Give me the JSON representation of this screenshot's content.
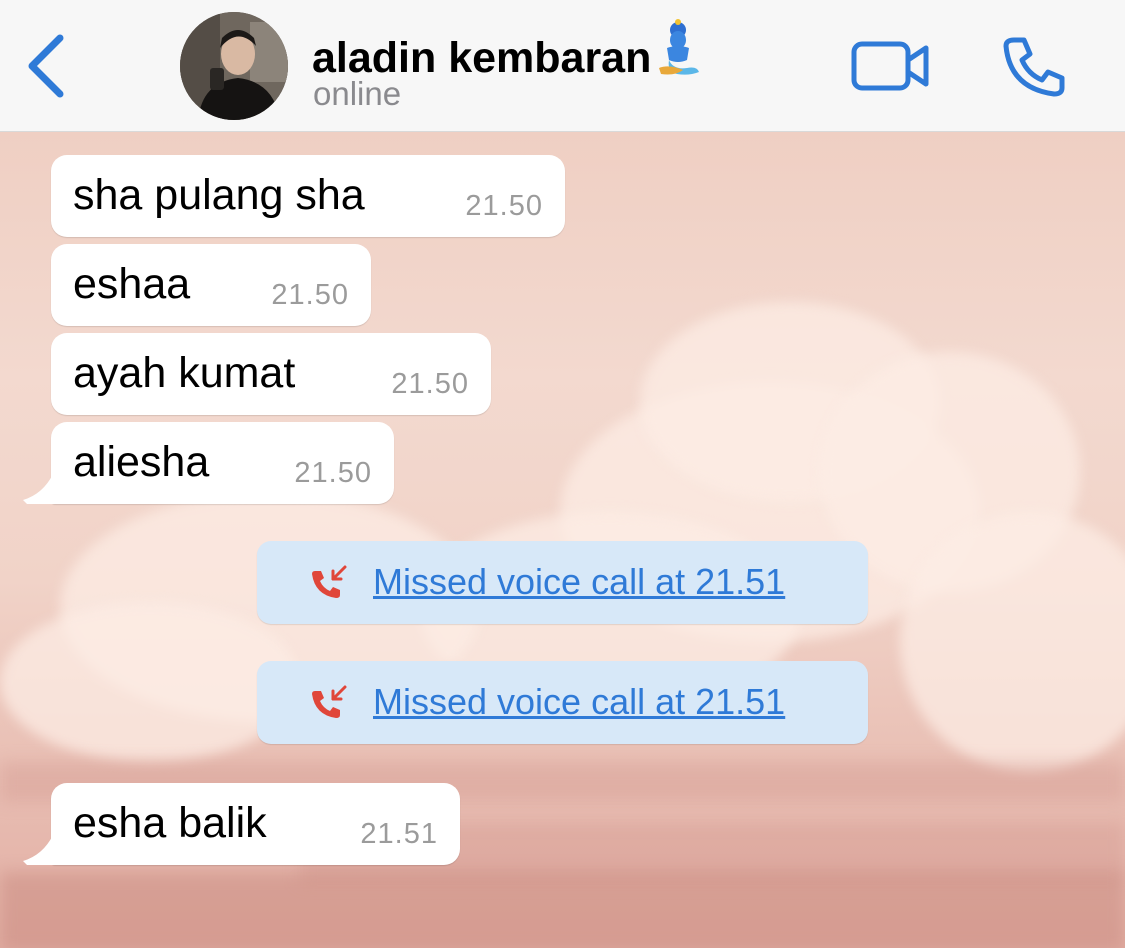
{
  "header": {
    "back_icon": "chevron-left-icon",
    "contact_name": "aladin kembaran",
    "name_emoji": "genie-icon",
    "status": "online",
    "video_icon": "video-camera-icon",
    "call_icon": "phone-icon",
    "accent_color": "#2f7ad7"
  },
  "messages": [
    {
      "text": "sha pulang sha",
      "time": "21.50"
    },
    {
      "text": "eshaa",
      "time": "21.50"
    },
    {
      "text": "ayah kumat",
      "time": "21.50"
    },
    {
      "text": "aliesha",
      "time": "21.50"
    },
    {
      "text": "esha balik",
      "time": "21.51"
    }
  ],
  "system_events": [
    {
      "icon": "missed-call-icon",
      "text": "Missed voice call at 21.51",
      "color": "#e0463a"
    },
    {
      "icon": "missed-call-icon",
      "text": "Missed voice call at 21.51",
      "color": "#e0463a"
    }
  ]
}
